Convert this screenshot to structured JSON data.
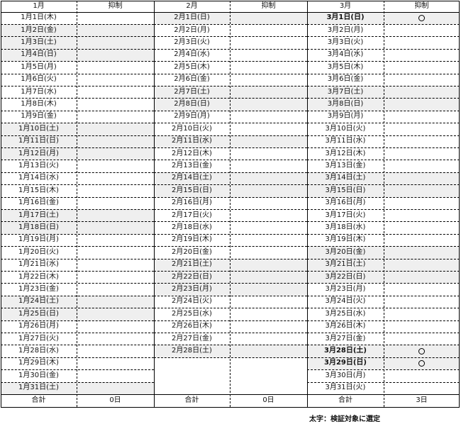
{
  "table": {
    "columns": [
      {
        "month_header": "1月",
        "restraint_header": "抑制",
        "days": [
          {
            "date": "1月1日(木)",
            "gray": false,
            "bold": false,
            "mark": ""
          },
          {
            "date": "1月2日(金)",
            "gray": true,
            "bold": false,
            "mark": ""
          },
          {
            "date": "1月3日(土)",
            "gray": true,
            "bold": false,
            "mark": ""
          },
          {
            "date": "1月4日(日)",
            "gray": true,
            "bold": false,
            "mark": ""
          },
          {
            "date": "1月5日(月)",
            "gray": false,
            "bold": false,
            "mark": ""
          },
          {
            "date": "1月6日(火)",
            "gray": false,
            "bold": false,
            "mark": ""
          },
          {
            "date": "1月7日(水)",
            "gray": false,
            "bold": false,
            "mark": ""
          },
          {
            "date": "1月8日(木)",
            "gray": false,
            "bold": false,
            "mark": ""
          },
          {
            "date": "1月9日(金)",
            "gray": false,
            "bold": false,
            "mark": ""
          },
          {
            "date": "1月10日(土)",
            "gray": true,
            "bold": false,
            "mark": ""
          },
          {
            "date": "1月11日(日)",
            "gray": true,
            "bold": false,
            "mark": ""
          },
          {
            "date": "1月12日(月)",
            "gray": true,
            "bold": false,
            "mark": ""
          },
          {
            "date": "1月13日(火)",
            "gray": false,
            "bold": false,
            "mark": ""
          },
          {
            "date": "1月14日(水)",
            "gray": false,
            "bold": false,
            "mark": ""
          },
          {
            "date": "1月15日(木)",
            "gray": false,
            "bold": false,
            "mark": ""
          },
          {
            "date": "1月16日(金)",
            "gray": false,
            "bold": false,
            "mark": ""
          },
          {
            "date": "1月17日(土)",
            "gray": true,
            "bold": false,
            "mark": ""
          },
          {
            "date": "1月18日(日)",
            "gray": true,
            "bold": false,
            "mark": ""
          },
          {
            "date": "1月19日(月)",
            "gray": false,
            "bold": false,
            "mark": ""
          },
          {
            "date": "1月20日(火)",
            "gray": false,
            "bold": false,
            "mark": ""
          },
          {
            "date": "1月21日(水)",
            "gray": false,
            "bold": false,
            "mark": ""
          },
          {
            "date": "1月22日(木)",
            "gray": false,
            "bold": false,
            "mark": ""
          },
          {
            "date": "1月23日(金)",
            "gray": false,
            "bold": false,
            "mark": ""
          },
          {
            "date": "1月24日(土)",
            "gray": true,
            "bold": false,
            "mark": ""
          },
          {
            "date": "1月25日(日)",
            "gray": true,
            "bold": false,
            "mark": ""
          },
          {
            "date": "1月26日(月)",
            "gray": false,
            "bold": false,
            "mark": ""
          },
          {
            "date": "1月27日(火)",
            "gray": false,
            "bold": false,
            "mark": ""
          },
          {
            "date": "1月28日(水)",
            "gray": false,
            "bold": false,
            "mark": ""
          },
          {
            "date": "1月29日(木)",
            "gray": false,
            "bold": false,
            "mark": ""
          },
          {
            "date": "1月30日(金)",
            "gray": false,
            "bold": false,
            "mark": ""
          },
          {
            "date": "1月31日(土)",
            "gray": true,
            "bold": false,
            "mark": ""
          }
        ],
        "total_label": "合計",
        "total_value": "0日"
      },
      {
        "month_header": "2月",
        "restraint_header": "抑制",
        "days": [
          {
            "date": "2月1日(日)",
            "gray": true,
            "bold": false,
            "mark": ""
          },
          {
            "date": "2月2日(月)",
            "gray": false,
            "bold": false,
            "mark": ""
          },
          {
            "date": "2月3日(火)",
            "gray": false,
            "bold": false,
            "mark": ""
          },
          {
            "date": "2月4日(水)",
            "gray": false,
            "bold": false,
            "mark": ""
          },
          {
            "date": "2月5日(木)",
            "gray": false,
            "bold": false,
            "mark": ""
          },
          {
            "date": "2月6日(金)",
            "gray": false,
            "bold": false,
            "mark": ""
          },
          {
            "date": "2月7日(土)",
            "gray": true,
            "bold": false,
            "mark": ""
          },
          {
            "date": "2月8日(日)",
            "gray": true,
            "bold": false,
            "mark": ""
          },
          {
            "date": "2月9日(月)",
            "gray": false,
            "bold": false,
            "mark": ""
          },
          {
            "date": "2月10日(火)",
            "gray": false,
            "bold": false,
            "mark": ""
          },
          {
            "date": "2月11日(水)",
            "gray": true,
            "bold": false,
            "mark": ""
          },
          {
            "date": "2月12日(木)",
            "gray": false,
            "bold": false,
            "mark": ""
          },
          {
            "date": "2月13日(金)",
            "gray": false,
            "bold": false,
            "mark": ""
          },
          {
            "date": "2月14日(土)",
            "gray": true,
            "bold": false,
            "mark": ""
          },
          {
            "date": "2月15日(日)",
            "gray": true,
            "bold": false,
            "mark": ""
          },
          {
            "date": "2月16日(月)",
            "gray": false,
            "bold": false,
            "mark": ""
          },
          {
            "date": "2月17日(火)",
            "gray": false,
            "bold": false,
            "mark": ""
          },
          {
            "date": "2月18日(水)",
            "gray": false,
            "bold": false,
            "mark": ""
          },
          {
            "date": "2月19日(木)",
            "gray": false,
            "bold": false,
            "mark": ""
          },
          {
            "date": "2月20日(金)",
            "gray": false,
            "bold": false,
            "mark": ""
          },
          {
            "date": "2月21日(土)",
            "gray": true,
            "bold": false,
            "mark": ""
          },
          {
            "date": "2月22日(日)",
            "gray": true,
            "bold": false,
            "mark": ""
          },
          {
            "date": "2月23日(月)",
            "gray": true,
            "bold": false,
            "mark": ""
          },
          {
            "date": "2月24日(火)",
            "gray": false,
            "bold": false,
            "mark": ""
          },
          {
            "date": "2月25日(水)",
            "gray": false,
            "bold": false,
            "mark": ""
          },
          {
            "date": "2月26日(木)",
            "gray": false,
            "bold": false,
            "mark": ""
          },
          {
            "date": "2月27日(金)",
            "gray": false,
            "bold": false,
            "mark": ""
          },
          {
            "date": "2月28日(土)",
            "gray": true,
            "bold": false,
            "mark": ""
          }
        ],
        "total_label": "合計",
        "total_value": "0日"
      },
      {
        "month_header": "3月",
        "restraint_header": "抑制",
        "days": [
          {
            "date": "3月1日(日)",
            "gray": true,
            "bold": true,
            "mark": "○"
          },
          {
            "date": "3月2日(月)",
            "gray": false,
            "bold": false,
            "mark": ""
          },
          {
            "date": "3月3日(火)",
            "gray": false,
            "bold": false,
            "mark": ""
          },
          {
            "date": "3月4日(水)",
            "gray": false,
            "bold": false,
            "mark": ""
          },
          {
            "date": "3月5日(木)",
            "gray": false,
            "bold": false,
            "mark": ""
          },
          {
            "date": "3月6日(金)",
            "gray": false,
            "bold": false,
            "mark": ""
          },
          {
            "date": "3月7日(土)",
            "gray": true,
            "bold": false,
            "mark": ""
          },
          {
            "date": "3月8日(日)",
            "gray": true,
            "bold": false,
            "mark": ""
          },
          {
            "date": "3月9日(月)",
            "gray": false,
            "bold": false,
            "mark": ""
          },
          {
            "date": "3月10日(火)",
            "gray": false,
            "bold": false,
            "mark": ""
          },
          {
            "date": "3月11日(水)",
            "gray": false,
            "bold": false,
            "mark": ""
          },
          {
            "date": "3月12日(木)",
            "gray": false,
            "bold": false,
            "mark": ""
          },
          {
            "date": "3月13日(金)",
            "gray": false,
            "bold": false,
            "mark": ""
          },
          {
            "date": "3月14日(土)",
            "gray": true,
            "bold": false,
            "mark": ""
          },
          {
            "date": "3月15日(日)",
            "gray": true,
            "bold": false,
            "mark": ""
          },
          {
            "date": "3月16日(月)",
            "gray": false,
            "bold": false,
            "mark": ""
          },
          {
            "date": "3月17日(火)",
            "gray": false,
            "bold": false,
            "mark": ""
          },
          {
            "date": "3月18日(水)",
            "gray": false,
            "bold": false,
            "mark": ""
          },
          {
            "date": "3月19日(木)",
            "gray": false,
            "bold": false,
            "mark": ""
          },
          {
            "date": "3月20日(金)",
            "gray": true,
            "bold": false,
            "mark": ""
          },
          {
            "date": "3月21日(土)",
            "gray": true,
            "bold": false,
            "mark": ""
          },
          {
            "date": "3月22日(日)",
            "gray": true,
            "bold": false,
            "mark": ""
          },
          {
            "date": "3月23日(月)",
            "gray": false,
            "bold": false,
            "mark": ""
          },
          {
            "date": "3月24日(火)",
            "gray": false,
            "bold": false,
            "mark": ""
          },
          {
            "date": "3月25日(水)",
            "gray": false,
            "bold": false,
            "mark": ""
          },
          {
            "date": "3月26日(木)",
            "gray": false,
            "bold": false,
            "mark": ""
          },
          {
            "date": "3月27日(金)",
            "gray": false,
            "bold": false,
            "mark": ""
          },
          {
            "date": "3月28日(土)",
            "gray": true,
            "bold": true,
            "mark": "○"
          },
          {
            "date": "3月29日(日)",
            "gray": true,
            "bold": true,
            "mark": "○"
          },
          {
            "date": "3月30日(月)",
            "gray": false,
            "bold": false,
            "mark": ""
          },
          {
            "date": "3月31日(火)",
            "gray": false,
            "bold": false,
            "mark": ""
          }
        ],
        "total_label": "合計",
        "total_value": "3日"
      }
    ]
  },
  "legend_note": "太字：検証対象に選定",
  "colors": {
    "holiday_fill": "#efefef",
    "border": "#000000"
  }
}
